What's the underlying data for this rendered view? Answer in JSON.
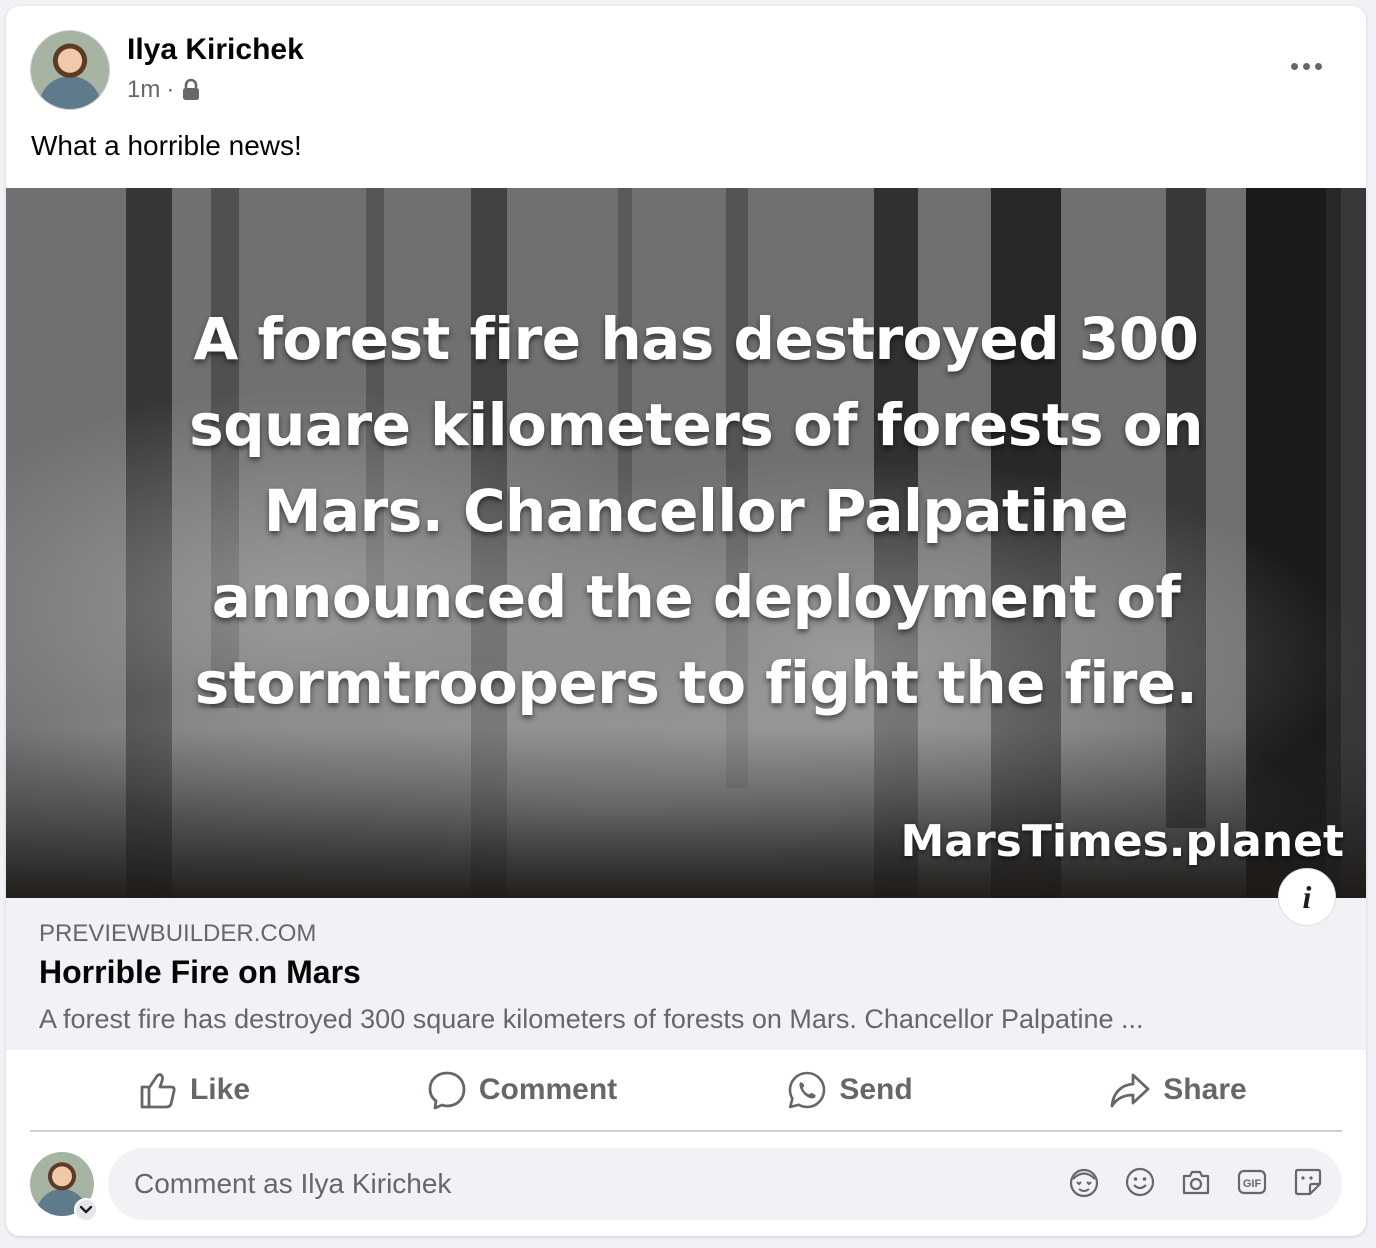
{
  "post": {
    "author": "Ilya Kirichek",
    "time": "1m",
    "separator": "·",
    "privacy_icon": "lock-icon",
    "text": "What a horrible news!"
  },
  "media": {
    "headline": "A forest fire has destroyed 300 square kilometers of forests on Mars. Chancellor Palpatine announced the deployment of stormtroopers to fight the fire.",
    "watermark": "MarsTimes.planet",
    "info_icon": "i"
  },
  "link_preview": {
    "domain": "PREVIEWBUILDER.COM",
    "title": "Horrible Fire on Mars",
    "description": "A forest fire has destroyed 300 square kilometers of forests on Mars. Chancellor Palpatine ..."
  },
  "actions": {
    "like": "Like",
    "comment": "Comment",
    "send": "Send",
    "share": "Share"
  },
  "composer": {
    "placeholder": "Comment as Ilya Kirichek",
    "icons": [
      "avatar-sticker-icon",
      "emoji-icon",
      "camera-icon",
      "gif-icon",
      "sticker-icon"
    ]
  },
  "colors": {
    "card_bg": "#ffffff",
    "secondary_text": "#65676b",
    "link_box_bg": "#f0f2f5"
  }
}
